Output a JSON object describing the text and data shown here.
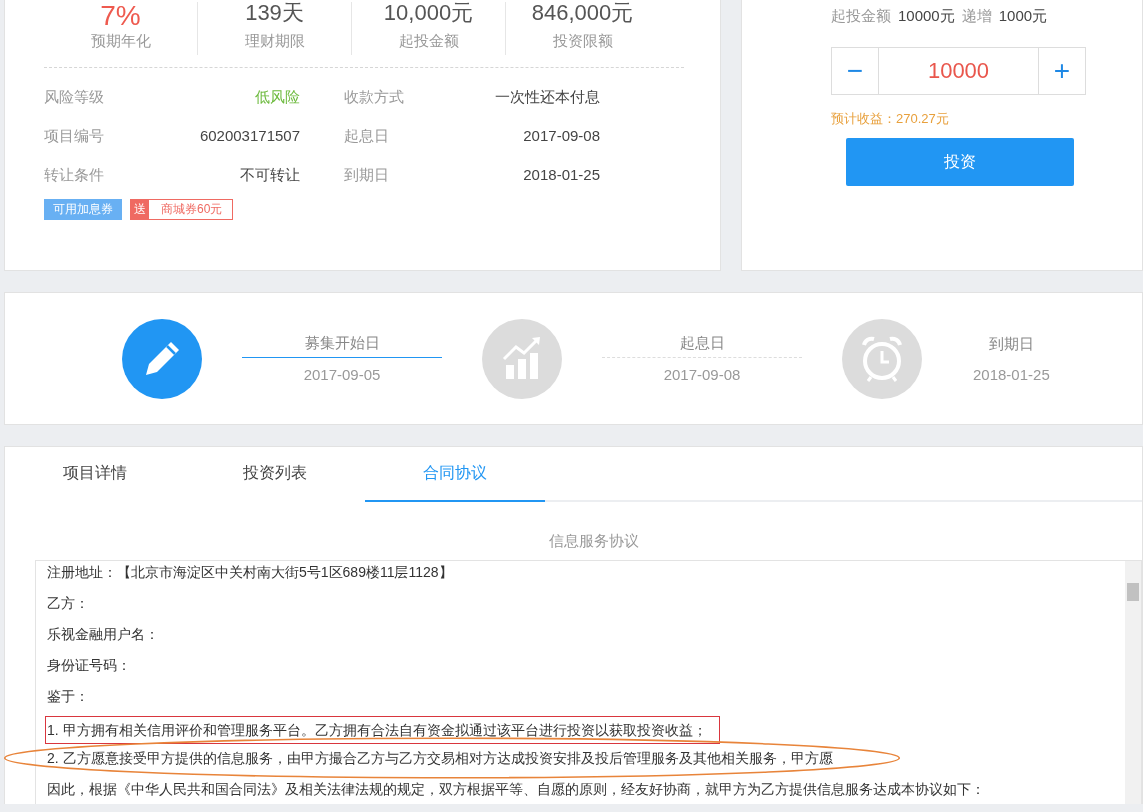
{
  "summary": {
    "stats": [
      {
        "value": "7%",
        "label": "预期年化",
        "kind": "rate"
      },
      {
        "value": "139天",
        "label": "理财期限",
        "kind": "plain"
      },
      {
        "value": "10,000元",
        "label": "起投金额",
        "kind": "plain"
      },
      {
        "value": "846,000元",
        "label": "投资限额",
        "kind": "plain"
      }
    ],
    "details": [
      {
        "label": "风险等级",
        "value": "低风险",
        "kind": "risk"
      },
      {
        "label": "收款方式",
        "value": "一次性还本付息",
        "kind": "plain"
      },
      {
        "label": "项目编号",
        "value": "602003171507",
        "kind": "plain"
      },
      {
        "label": "起息日",
        "value": "2017-09-08",
        "kind": "plain"
      },
      {
        "label": "转让条件",
        "value": "不可转让",
        "kind": "plain"
      },
      {
        "label": "到期日",
        "value": "2018-01-25",
        "kind": "plain"
      }
    ],
    "coupon_tag": "可用加息券",
    "gift_tag": {
      "badge": "送",
      "text": "商城券60元"
    }
  },
  "invest": {
    "min_label": "起投金额",
    "min_value": "10000元",
    "step_label": "递增",
    "step_value": "1000元",
    "minus": "−",
    "amount": "10000",
    "plus": "+",
    "expected": "预计收益：270.27元",
    "button": "投资"
  },
  "timeline": [
    {
      "label": "募集开始日",
      "date": "2017-09-05",
      "active": true,
      "kind": "pencil"
    },
    {
      "label": "起息日",
      "date": "2017-09-08",
      "active": false,
      "kind": "chart"
    },
    {
      "label": "到期日",
      "date": "2018-01-25",
      "active": false,
      "kind": "clock"
    }
  ],
  "tabs": [
    {
      "label": "项目详情",
      "selected": false
    },
    {
      "label": "投资列表",
      "selected": false
    },
    {
      "label": "合同协议",
      "selected": true
    }
  ],
  "contract": {
    "title": "信息服务协议",
    "lines": [
      {
        "text": "注册地址：【北京市海淀区中关村南大街5号1区689楼11层1128】",
        "boxed": false,
        "circled": false
      },
      {
        "text": "乙方：",
        "boxed": false,
        "circled": false
      },
      {
        "text": "乐视金融用户名：",
        "boxed": false,
        "circled": false
      },
      {
        "text": "身份证号码：",
        "boxed": false,
        "circled": false
      },
      {
        "text": "鉴于：",
        "boxed": false,
        "circled": false
      },
      {
        "text": "1. 甲方拥有相关信用评价和管理服务平台。乙方拥有合法自有资金拟通过该平台进行投资以获取投资收益；",
        "boxed": true,
        "circled": false
      },
      {
        "text": "2. 乙方愿意接受甲方提供的信息服务，由甲方撮合乙方与乙方交易相对方达成投资安排及投后管理服务及其他相关服务，甲方愿",
        "boxed": false,
        "circled": true
      },
      {
        "text": "因此，根据《中华人民共和国合同法》及相关法律法规的规定，双方根据平等、自愿的原则，经友好协商，就甲方为乙方提供信息服务达成本协议如下：",
        "boxed": false,
        "circled": false
      }
    ]
  }
}
